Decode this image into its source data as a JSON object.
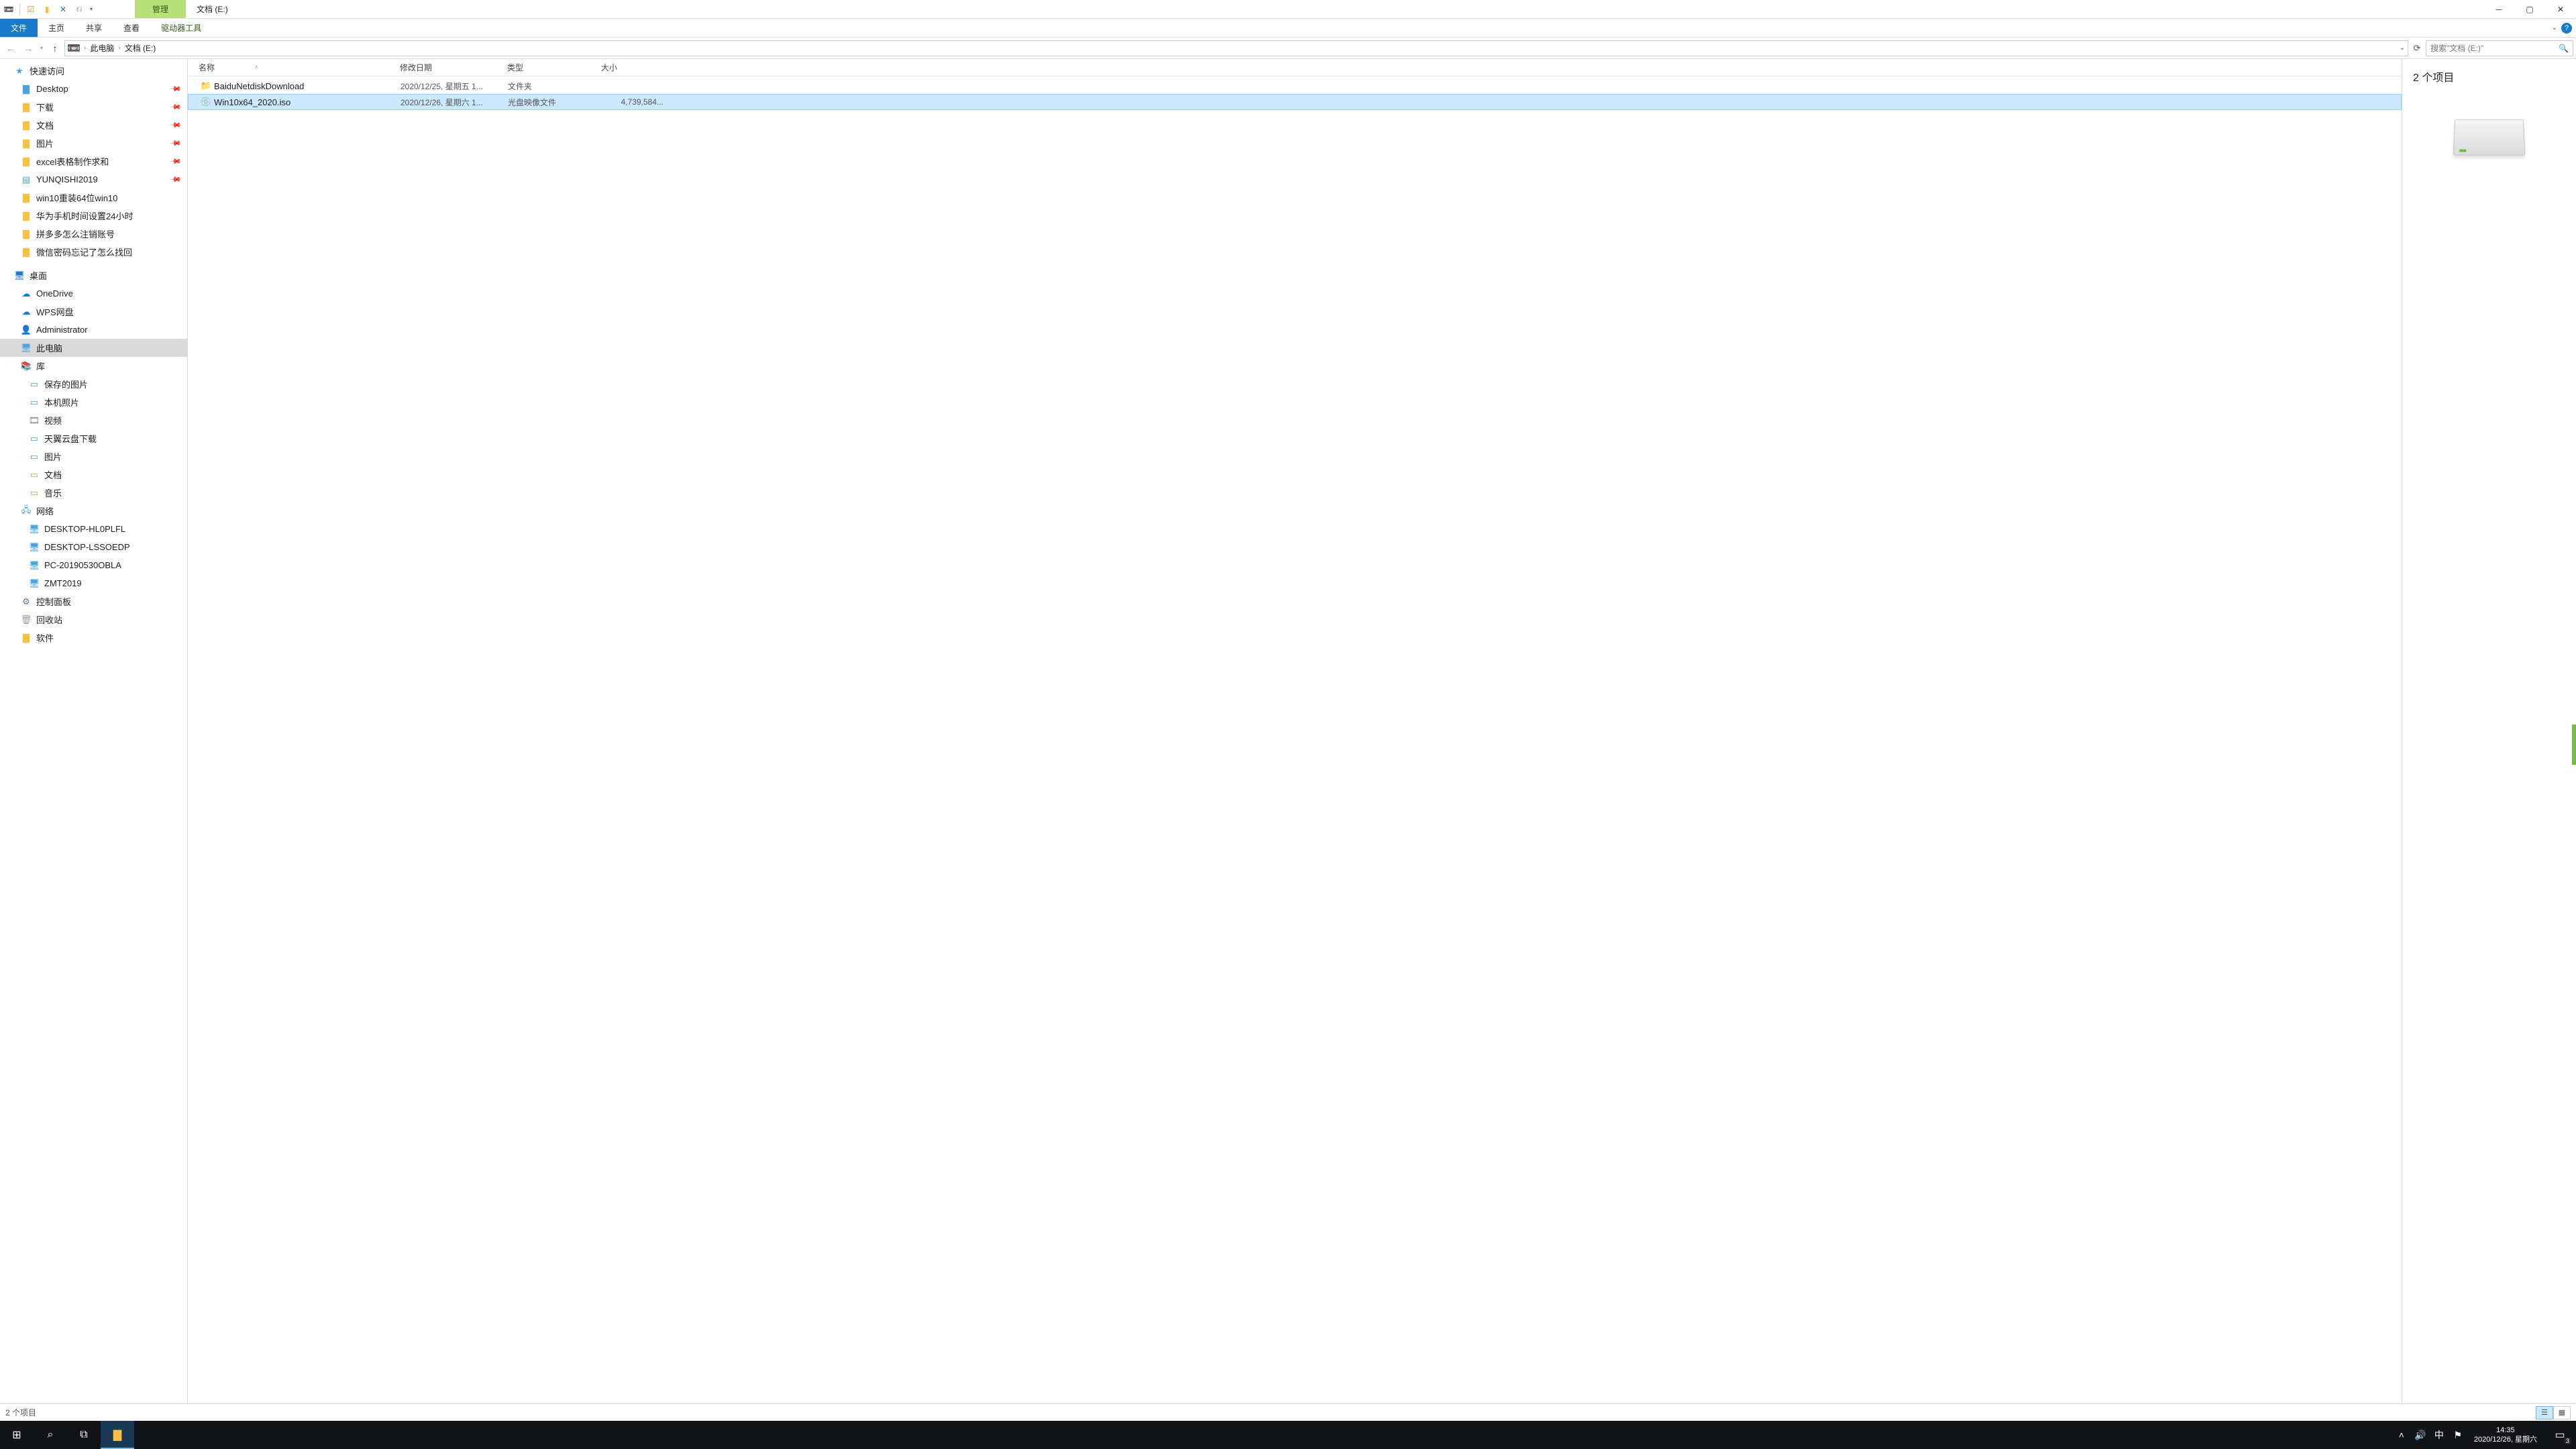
{
  "titlebar": {
    "context_tab": "管理",
    "title": "文档 (E:)"
  },
  "ribbon": {
    "file": "文件",
    "home": "主页",
    "share": "共享",
    "view": "查看",
    "drive_tools": "驱动器工具"
  },
  "nav": {
    "crumb1": "此电脑",
    "crumb2": "文档 (E:)",
    "search_placeholder": "搜索\"文档 (E:)\""
  },
  "tree": {
    "quick_access": "快速访问",
    "desktop": "Desktop",
    "downloads": "下载",
    "documents": "文档",
    "pictures": "图片",
    "excel": "excel表格制作求和",
    "yunqishi": "YUNQISHI2019",
    "win10re": "win10重装64位win10",
    "huawei": "华为手机时间设置24小时",
    "pdd": "拼多多怎么注销账号",
    "wechat": "微信密码忘记了怎么找回",
    "desk": "桌面",
    "onedrive": "OneDrive",
    "wps": "WPS网盘",
    "admin": "Administrator",
    "thispc": "此电脑",
    "lib": "库",
    "savedpics": "保存的图片",
    "camera": "本机照片",
    "video": "视频",
    "tianyi": "天翼云盘下载",
    "pics2": "图片",
    "docs2": "文档",
    "music": "音乐",
    "network": "网络",
    "pc1": "DESKTOP-HL0PLFL",
    "pc2": "DESKTOP-LSSOEDP",
    "pc3": "PC-20190530OBLA",
    "pc4": "ZMT2019",
    "cpanel": "控制面板",
    "recycle": "回收站",
    "software": "软件"
  },
  "columns": {
    "name": "名称",
    "date": "修改日期",
    "type": "类型",
    "size": "大小"
  },
  "files": [
    {
      "name": "BaiduNetdiskDownload",
      "date": "2020/12/25, 星期五 1...",
      "type": "文件夹",
      "size": "",
      "icon": "folder",
      "sel": false
    },
    {
      "name": "Win10x64_2020.iso",
      "date": "2020/12/26, 星期六 1...",
      "type": "光盘映像文件",
      "size": "4,739,584...",
      "icon": "disc",
      "sel": true
    }
  ],
  "preview": {
    "title": "2 个项目"
  },
  "statusbar": {
    "count": "2 个项目"
  },
  "taskbar": {
    "time": "14:35",
    "date": "2020/12/26, 星期六",
    "ime": "中",
    "notif_count": "3"
  }
}
